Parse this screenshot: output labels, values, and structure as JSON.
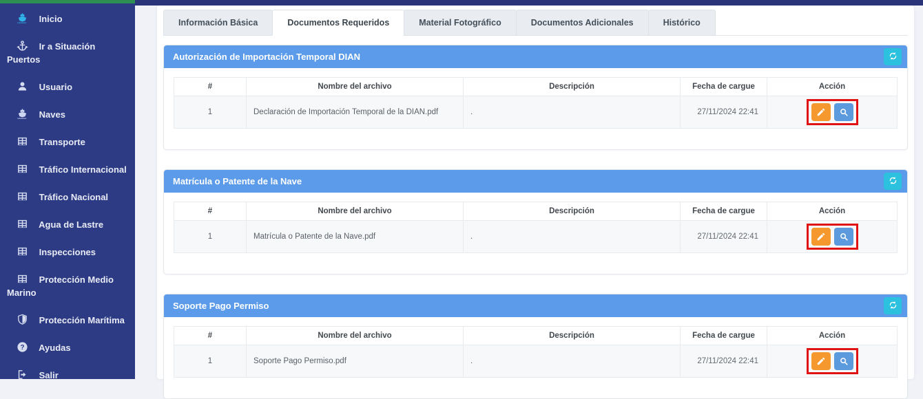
{
  "sidebar": {
    "items": [
      {
        "label": "Inicio",
        "icon": "ship-icon",
        "icon_color": "#2fb3e8"
      },
      {
        "label": "Ir a Situación Puertos",
        "icon": "anchor-icon"
      },
      {
        "label": "Usuario",
        "icon": "user-icon"
      },
      {
        "label": "Naves",
        "icon": "ship-icon",
        "icon_color": "#cdd7f2"
      },
      {
        "label": "Transporte",
        "icon": "table-icon"
      },
      {
        "label": "Tráfico Internacional",
        "icon": "table-icon"
      },
      {
        "label": "Tráfico Nacional",
        "icon": "table-icon"
      },
      {
        "label": "Agua de Lastre",
        "icon": "table-icon"
      },
      {
        "label": "Inspecciones",
        "icon": "table-icon"
      },
      {
        "label": "Protección Medio Marino",
        "icon": "table-icon"
      },
      {
        "label": "Protección Marítima",
        "icon": "shield-icon"
      },
      {
        "label": "Ayudas",
        "icon": "question-icon"
      },
      {
        "label": "Salir",
        "icon": "exit-icon"
      }
    ]
  },
  "tabs": [
    {
      "label": "Información Básica",
      "active": false
    },
    {
      "label": "Documentos Requeridos",
      "active": true
    },
    {
      "label": "Material Fotográfico",
      "active": false
    },
    {
      "label": "Documentos Adicionales",
      "active": false
    },
    {
      "label": "Histórico",
      "active": false
    }
  ],
  "table": {
    "headers": [
      "#",
      "Nombre del archivo",
      "Descripción",
      "Fecha de cargue",
      "Acción"
    ]
  },
  "panels": [
    {
      "title": "Autorización de Importación Temporal DIAN",
      "rows": [
        {
          "num": "1",
          "file": "Declaración de Importación Temporal de la DIAN.pdf",
          "desc": ".",
          "date": "27/11/2024 22:41"
        }
      ]
    },
    {
      "title": "Matrícula o Patente de la Nave",
      "rows": [
        {
          "num": "1",
          "file": "Matrícula o Patente de la Nave.pdf",
          "desc": ".",
          "date": "27/11/2024 22:41"
        }
      ]
    },
    {
      "title": "Soporte Pago Permiso",
      "rows": [
        {
          "num": "1",
          "file": "Soporte Pago Permiso.pdf",
          "desc": ".",
          "date": "27/11/2024 22:41"
        }
      ]
    }
  ],
  "action_icons": {
    "edit": "pencil-icon",
    "view": "search-icon",
    "refresh": "refresh-icon"
  },
  "colors": {
    "topbar_green": "#2e8f55",
    "topbar_navy": "#293578",
    "sidebar_bg": "#2d3b85",
    "content_bg": "#f0f2f7",
    "panel_header": "#5b9bea",
    "refresh_button": "#2cc1de",
    "edit_button": "#f5992f",
    "search_button": "#5b9bdd",
    "highlight_box": "#e01212"
  }
}
